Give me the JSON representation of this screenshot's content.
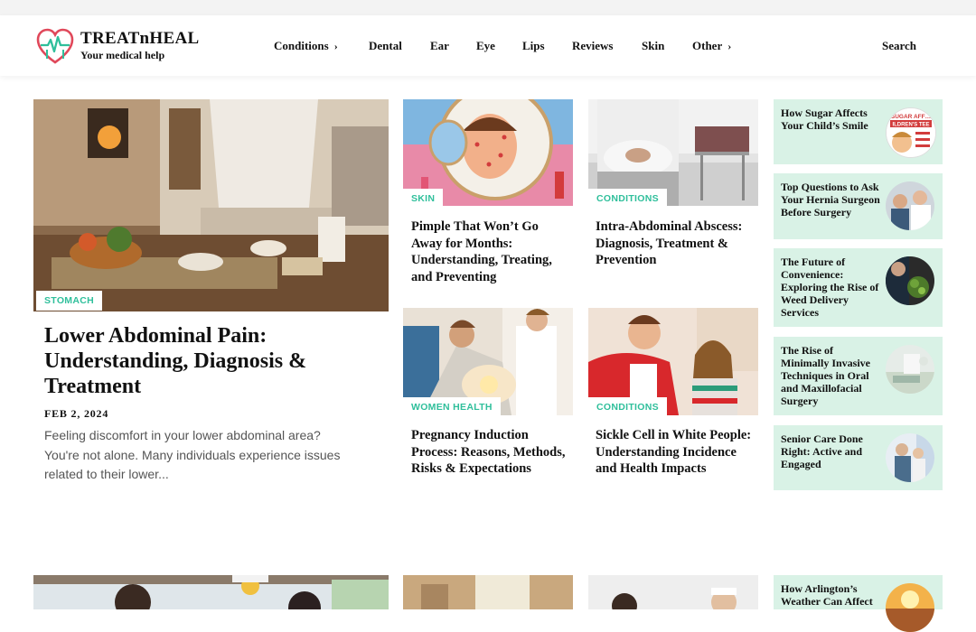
{
  "site": {
    "name": "TREATnHEAL",
    "tagline": "Your medical help"
  },
  "nav": [
    {
      "label": "Conditions",
      "has_submenu": true
    },
    {
      "label": "Dental",
      "has_submenu": false
    },
    {
      "label": "Ear",
      "has_submenu": false
    },
    {
      "label": "Eye",
      "has_submenu": false
    },
    {
      "label": "Lips",
      "has_submenu": false
    },
    {
      "label": "Reviews",
      "has_submenu": false
    },
    {
      "label": "Skin",
      "has_submenu": false
    },
    {
      "label": "Other",
      "has_submenu": true
    }
  ],
  "search_label": "Search",
  "featured": {
    "category": "STOMACH",
    "title": "Lower Abdominal Pain: Understanding, Diagnosis & Treatment",
    "date": "FEB 2, 2024",
    "excerpt": "Feeling discomfort in your lower abdominal area? You're not alone. Many individuals experience issues related to their lower..."
  },
  "grid": [
    {
      "category": "SKIN",
      "title": "Pimple That Won’t Go Away for Months: Understanding, Treating, and Preventing"
    },
    {
      "category": "CONDITIONS",
      "title": "Intra-Abdominal Abscess: Diagnosis, Treatment & Prevention"
    },
    {
      "category": "WOMEN HEALTH",
      "title": "Pregnancy Induction Process: Reasons, Methods, Risks & Expectations"
    },
    {
      "category": "CONDITIONS",
      "title": "Sickle Cell in White People: Understanding Incidence and Health Impacts"
    }
  ],
  "sidebar": [
    {
      "title": "How Sugar Affects Your Child’s Smile",
      "thumb_text": "SUGAR AFF… ILDREN'S TEE"
    },
    {
      "title": "Top Questions to Ask Your Hernia Surgeon Before Surgery"
    },
    {
      "title": "The Future of Convenience: Exploring the Rise of Weed Delivery Services"
    },
    {
      "title": "The Rise of Minimally Invasive Techniques in Oral and Maxillofacial Surgery"
    },
    {
      "title": "Senior Care Done Right: Active and Engaged"
    },
    {
      "title": "How Arlington’s Weather Can Affect"
    }
  ],
  "colors": {
    "accent": "#2fbf9b",
    "sidebar_bg": "#d9f2e6",
    "logo_red": "#e0485a"
  }
}
